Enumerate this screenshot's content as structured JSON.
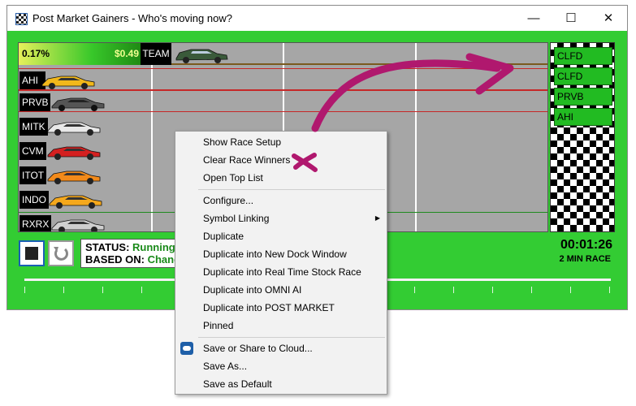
{
  "window": {
    "title": "Post Market Gainers - Who's moving now?",
    "controls": {
      "minimize": "—",
      "maximize": "☐",
      "close": "✕"
    }
  },
  "race": {
    "team": {
      "percent": "0.17%",
      "amount": "$0.49",
      "label": "TEAM",
      "car_color": "#3a5a3a"
    },
    "lanes": [
      {
        "symbol": "AHI",
        "car_color": "#f2b81a"
      },
      {
        "symbol": "PRVB",
        "car_color": "#555555"
      },
      {
        "symbol": "MITK",
        "car_color": "#e8e8e8"
      },
      {
        "symbol": "CVM",
        "car_color": "#d42020"
      },
      {
        "symbol": "ITOT",
        "car_color": "#f28a1a"
      },
      {
        "symbol": "INDO",
        "car_color": "#f5a81c"
      },
      {
        "symbol": "RXRX",
        "car_color": "#cfcfcf"
      }
    ],
    "winners": [
      "CLFD",
      "CLFD",
      "PRVB",
      "AHI"
    ]
  },
  "status": {
    "status_label": "STATUS:",
    "status_value": "Running",
    "based_label": "BASED ON:",
    "based_value": "Change"
  },
  "timer": {
    "time": "00:01:26",
    "mode": "2 MIN RACE"
  },
  "context_menu": {
    "items": [
      "Show Race Setup",
      "Clear Race Winners",
      "Open Top List",
      "Configure...",
      "Symbol Linking",
      "Duplicate",
      "Duplicate into New Dock Window",
      "Duplicate into Real Time Stock Race",
      "Duplicate into OMNI AI",
      "Duplicate into POST MARKET",
      "Pinned",
      "Save or Share to Cloud...",
      "Save As...",
      "Save as Default"
    ],
    "submenu_arrow": "▶"
  },
  "colors": {
    "background_green": "#33cc33",
    "annotation_magenta": "#b0186e",
    "status_green": "#1a8a1a"
  }
}
